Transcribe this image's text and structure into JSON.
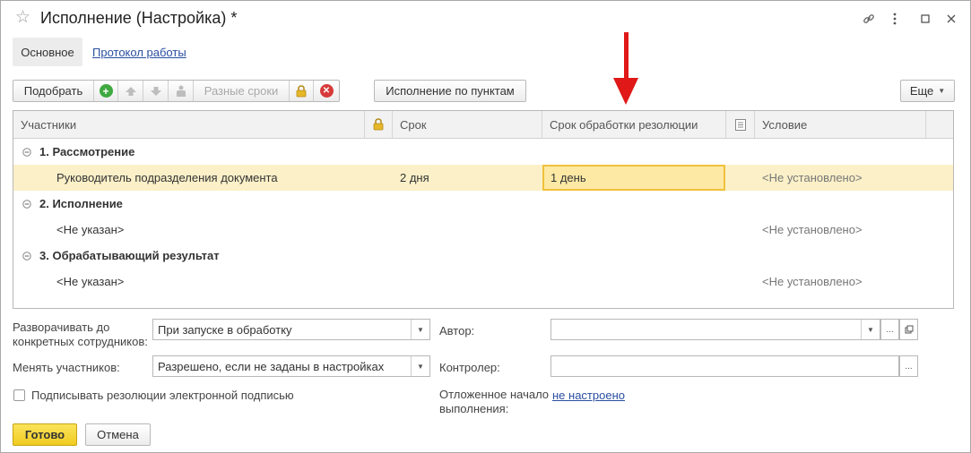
{
  "window": {
    "title": "Исполнение (Настройка) *"
  },
  "tabs": {
    "main_label": "Основное",
    "log_label": "Протокол работы"
  },
  "toolbar": {
    "pick_label": "Подобрать",
    "diff_terms_label": "Разные сроки",
    "by_items_label": "Исполнение по пунктам",
    "more_label": "Еще"
  },
  "table": {
    "columns": {
      "participants": "Участники",
      "term": "Срок",
      "resolution_term": "Срок обработки резолюции",
      "condition": "Условие"
    },
    "groups": [
      {
        "title": "1. Рассмотрение",
        "participant": "Руководитель подразделения документа",
        "term": "2 дня",
        "resolution_term": "1 день",
        "condition": "<Не установлено>"
      },
      {
        "title": "2. Исполнение",
        "participant": "<Не указан>",
        "term": "",
        "resolution_term": "",
        "condition": "<Не установлено>"
      },
      {
        "title": "3. Обрабатывающий результат",
        "participant": "<Не указан>",
        "term": "",
        "resolution_term": "",
        "condition": "<Не установлено>"
      }
    ]
  },
  "form": {
    "expand_label_line1": "Разворачивать до",
    "expand_label_line2": "конкретных сотрудников:",
    "expand_value": "При запуске в обработку",
    "change_label": "Менять участников:",
    "change_value": "Разрешено, если не заданы в настройках",
    "sign_label": "Подписывать резолюции электронной подписью",
    "author_label": "Автор:",
    "author_value": "",
    "controller_label": "Контролер:",
    "controller_value": "",
    "deferred_label_line1": "Отложенное начало",
    "deferred_label_line2": "выполнения:",
    "deferred_value": "не настроено"
  },
  "footer": {
    "ok_label": "Готово",
    "cancel_label": "Отмена"
  },
  "colors": {
    "accent_yellow": "#f5d631",
    "selected_row": "#fbf0c8",
    "edit_cell": "#fde9a4",
    "link_blue": "#2a4ea0",
    "annotation_arrow": "#e01818",
    "add_green": "#3fa83f",
    "delete_red": "#d63a3a"
  },
  "icons": [
    "star-icon",
    "link-icon",
    "more-vert-icon",
    "minimize-icon",
    "close-icon",
    "add-icon",
    "move-up-icon",
    "move-down-icon",
    "person-icon",
    "lock-icon",
    "delete-icon",
    "collapse-icon",
    "dropdown-icon",
    "open-form-icon",
    "annotation-arrow-icon"
  ]
}
